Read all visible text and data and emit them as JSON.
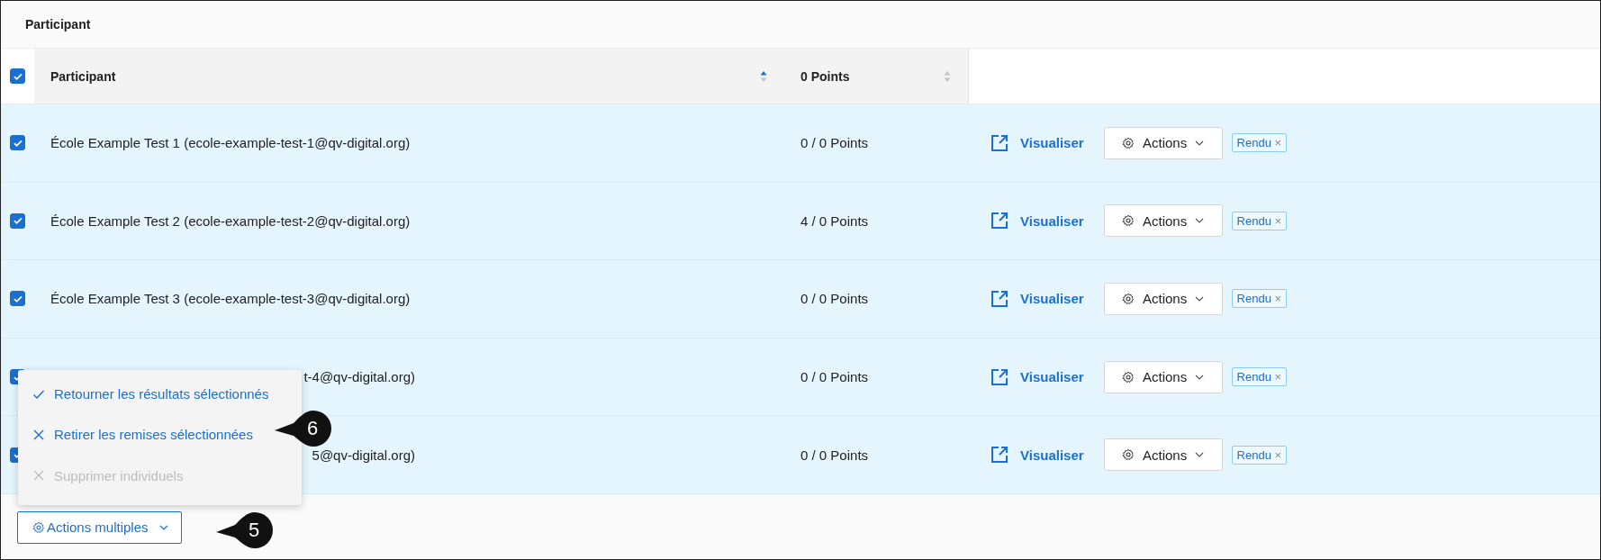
{
  "title": "Participant",
  "select_all": {
    "checked": true
  },
  "columns": [
    {
      "label": "Participant",
      "sorted": true
    },
    {
      "label": "0 Points",
      "sorted": false
    }
  ],
  "rows": [
    {
      "kind": "full",
      "checked": true,
      "name": "École Example Test 1 (ecole-example-test-1@qv-digital.org)",
      "points": "0 / 0 Points",
      "view": "Visualiser",
      "actions": "Actions",
      "tag": "Rendu",
      "tag_close": "×"
    },
    {
      "kind": "full",
      "checked": true,
      "name": "École Example Test 2 (ecole-example-test-2@qv-digital.org)",
      "points": "4 / 0 Points",
      "view": "Visualiser",
      "actions": "Actions",
      "tag": "Rendu",
      "tag_close": "×"
    },
    {
      "kind": "full",
      "checked": true,
      "name": "École Example Test 3 (ecole-example-test-3@qv-digital.org)",
      "points": "0 / 0 Points",
      "view": "Visualiser",
      "actions": "Actions",
      "tag": "Rendu",
      "tag_close": "×"
    },
    {
      "kind": "partial",
      "checked": true,
      "name": "t-4@qv-digital.org)",
      "points": "0 / 0 Points",
      "view": "Visualiser",
      "actions": "Actions",
      "tag": "Rendu",
      "tag_close": "×"
    },
    {
      "kind": "partial",
      "checked": true,
      "name": "5@qv-digital.org)",
      "points": "0 / 0 Points",
      "view": "Visualiser",
      "actions": "Actions",
      "tag": "Rendu",
      "tag_close": "×"
    }
  ],
  "menu": [
    {
      "kind": "check",
      "label": "Retourner les résultats sélectionnés",
      "disabled": false
    },
    {
      "kind": "cross",
      "label": "Retirer les remises sélectionnées",
      "disabled": false
    },
    {
      "kind": "cross",
      "label": "Supprimer individuels",
      "disabled": true
    }
  ],
  "bulk_button": {
    "label": "Actions multiples"
  },
  "callouts": [
    {
      "number": "6"
    },
    {
      "number": "5"
    }
  ]
}
